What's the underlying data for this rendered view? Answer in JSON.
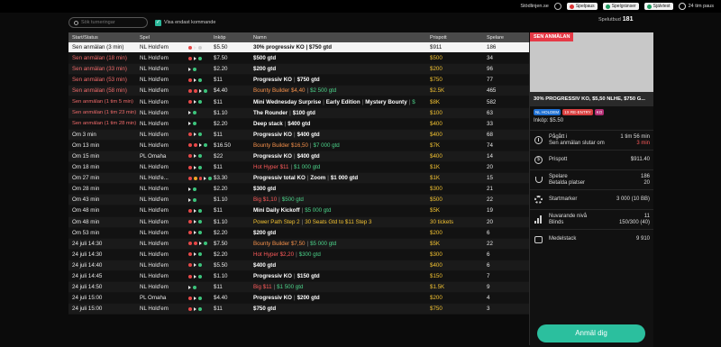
{
  "topbar": {
    "site": "Stödlinjen.se",
    "badges": [
      "Spelpaus",
      "Spelgränser",
      "Självtest"
    ],
    "session": "24 tim paus"
  },
  "filters": {
    "search_placeholder": "Sök turneringar",
    "upcoming_label": "Visa endast kommande",
    "spelutbud_label": "Spelutbud",
    "spelutbud_count": "181"
  },
  "table": {
    "headers": [
      "Start/Status",
      "Spel",
      "Inköp",
      "Namn",
      "Prispott",
      "Spelare"
    ],
    "rows": [
      {
        "start": "Sen anmälan (3 min)",
        "spel": "NL Hold'em",
        "inkop": "$5.50",
        "namn": [
          {
            "t": "30% progressiv KO | $750 gtd",
            "c": "white"
          }
        ],
        "prispott": "$911",
        "spelare": "186",
        "state": "white",
        "sel": true,
        "icons": [
          "r",
          "tri",
          "w"
        ]
      },
      {
        "start": "Sen anmälan (18 min)",
        "spel": "NL Hold'em",
        "inkop": "$7.50",
        "namn": [
          {
            "t": "$500 gtd",
            "c": "white"
          }
        ],
        "prispott": "$500",
        "spelare": "34",
        "state": "red",
        "icons": [
          "r",
          "tri",
          "g"
        ]
      },
      {
        "start": "Sen anmälan (33 min)",
        "spel": "NL Hold'em",
        "inkop": "$2.20",
        "namn": [
          {
            "t": "$200 gtd",
            "c": "white"
          }
        ],
        "prispott": "$200",
        "spelare": "96",
        "state": "red",
        "icons": [
          "tri",
          "g"
        ]
      },
      {
        "start": "Sen anmälan (53 min)",
        "spel": "NL Hold'em",
        "inkop": "$11",
        "namn": [
          {
            "t": "Progressiv KO",
            "c": "white"
          },
          {
            "t": "|",
            "c": "sep"
          },
          {
            "t": "$750 gtd",
            "c": "white"
          }
        ],
        "prispott": "$750",
        "spelare": "77",
        "state": "red",
        "icons": [
          "r",
          "tri",
          "g"
        ]
      },
      {
        "start": "Sen anmälan (58 min)",
        "spel": "NL Hold'em",
        "inkop": "$4.40",
        "namn": [
          {
            "t": "Bounty Builder $4,40",
            "c": "orange"
          },
          {
            "t": "|",
            "c": "sep"
          },
          {
            "t": "$2 500 gtd",
            "c": "green"
          }
        ],
        "prispott": "$2.5K",
        "spelare": "465",
        "state": "red",
        "icons": [
          "r",
          "r",
          "tri",
          "g"
        ]
      },
      {
        "start": "Sen anmälan (1 tim 5 min)",
        "spel": "NL Hold'em",
        "inkop": "$11",
        "namn": [
          {
            "t": "Mini Wednesday Surprise",
            "c": "white"
          },
          {
            "t": "|",
            "c": "sep"
          },
          {
            "t": "Early Edition",
            "c": "white"
          },
          {
            "t": "|",
            "c": "sep"
          },
          {
            "t": "Mystery Bounty",
            "c": "white"
          },
          {
            "t": "|",
            "c": "sep"
          },
          {
            "t": "$",
            "c": "green"
          }
        ],
        "prispott": "$8K",
        "spelare": "582",
        "state": "red",
        "two": true,
        "icons": [
          "r",
          "tri",
          "g"
        ]
      },
      {
        "start": "Sen anmälan (1 tim 23 min)",
        "spel": "NL Hold'em",
        "inkop": "$1.10",
        "namn": [
          {
            "t": "The Rounder",
            "c": "white"
          },
          {
            "t": "|",
            "c": "sep"
          },
          {
            "t": "$100 gtd",
            "c": "white"
          }
        ],
        "prispott": "$100",
        "spelare": "63",
        "state": "red",
        "two": true,
        "icons": [
          "tri",
          "g"
        ]
      },
      {
        "start": "Sen anmälan (1 tim 28 min)",
        "spel": "NL Hold'em",
        "inkop": "$2.20",
        "namn": [
          {
            "t": "Deep stack",
            "c": "white"
          },
          {
            "t": "|",
            "c": "sep"
          },
          {
            "t": "$400 gtd",
            "c": "white"
          }
        ],
        "prispott": "$400",
        "spelare": "33",
        "state": "red",
        "two": true,
        "icons": [
          "tri",
          "g"
        ]
      },
      {
        "start": "Om 3 min",
        "spel": "NL Hold'em",
        "inkop": "$11",
        "namn": [
          {
            "t": "Progressiv KO",
            "c": "white"
          },
          {
            "t": "|",
            "c": "sep"
          },
          {
            "t": "$400 gtd",
            "c": "white"
          }
        ],
        "prispott": "$400",
        "spelare": "68",
        "state": "white",
        "icons": [
          "r",
          "tri",
          "g"
        ]
      },
      {
        "start": "Om 13 min",
        "spel": "NL Hold'em",
        "inkop": "$16.50",
        "namn": [
          {
            "t": "Bounty Builder $16,50",
            "c": "orange"
          },
          {
            "t": "|",
            "c": "sep"
          },
          {
            "t": "$7 000 gtd",
            "c": "green"
          }
        ],
        "prispott": "$7K",
        "spelare": "74",
        "state": "white",
        "icons": [
          "r",
          "r",
          "tri",
          "g"
        ]
      },
      {
        "start": "Om 15 min",
        "spel": "PL Omaha",
        "inkop": "$22",
        "namn": [
          {
            "t": "Progressiv KO",
            "c": "white"
          },
          {
            "t": "|",
            "c": "sep"
          },
          {
            "t": "$400 gtd",
            "c": "white"
          }
        ],
        "prispott": "$400",
        "spelare": "14",
        "state": "white",
        "icons": [
          "r",
          "tri",
          "g"
        ]
      },
      {
        "start": "Om 18 min",
        "spel": "NL Hold'em",
        "inkop": "$11",
        "namn": [
          {
            "t": "Hot Hyper $11",
            "c": "red"
          },
          {
            "t": "|",
            "c": "sep"
          },
          {
            "t": "$1 000 gtd",
            "c": "green"
          }
        ],
        "prispott": "$1K",
        "spelare": "20",
        "state": "white",
        "icons": [
          "r",
          "tri",
          "g"
        ]
      },
      {
        "start": "Om 27 min",
        "spel": "NL Hold'e...",
        "inkop": "$3.30",
        "namn": [
          {
            "t": "Progressiv total KO",
            "c": "white"
          },
          {
            "t": "|",
            "c": "sep"
          },
          {
            "t": "Zoom",
            "c": "white"
          },
          {
            "t": "|",
            "c": "sep"
          },
          {
            "t": "$1 000 gtd",
            "c": "white"
          }
        ],
        "prispott": "$1K",
        "spelare": "15",
        "state": "white",
        "icons": [
          "r",
          "o",
          "r",
          "tri",
          "g"
        ]
      },
      {
        "start": "Om 28 min",
        "spel": "NL Hold'em",
        "inkop": "$2.20",
        "namn": [
          {
            "t": "$300 gtd",
            "c": "white"
          }
        ],
        "prispott": "$300",
        "spelare": "21",
        "state": "white",
        "icons": [
          "tri",
          "g"
        ]
      },
      {
        "start": "Om 43 min",
        "spel": "NL Hold'em",
        "inkop": "$1.10",
        "namn": [
          {
            "t": "Big $1,10",
            "c": "red"
          },
          {
            "t": "|",
            "c": "sep"
          },
          {
            "t": "$500 gtd",
            "c": "green"
          }
        ],
        "prispott": "$500",
        "spelare": "22",
        "state": "white",
        "icons": [
          "tri",
          "g"
        ]
      },
      {
        "start": "Om 48 min",
        "spel": "NL Hold'em",
        "inkop": "$11",
        "namn": [
          {
            "t": "Mini Daily Kickoff",
            "c": "white"
          },
          {
            "t": "|",
            "c": "sep"
          },
          {
            "t": "$5 000 gtd",
            "c": "green"
          }
        ],
        "prispott": "$5K",
        "spelare": "19",
        "state": "white",
        "icons": [
          "r",
          "tri",
          "g"
        ]
      },
      {
        "start": "Om 48 min",
        "spel": "NL Hold'em",
        "inkop": "$1.10",
        "namn": [
          {
            "t": "Power Path Step 2",
            "c": "yellow"
          },
          {
            "t": "|",
            "c": "sep"
          },
          {
            "t": "30 Seats Gtd to $11 Step 3",
            "c": "yellow"
          }
        ],
        "prispott": "30 tickets",
        "spelare": "20",
        "state": "white",
        "pzy": true,
        "icons": [
          "r",
          "tri",
          "g"
        ]
      },
      {
        "start": "Om 53 min",
        "spel": "NL Hold'em",
        "inkop": "$2.20",
        "namn": [
          {
            "t": "$200 gtd",
            "c": "white"
          }
        ],
        "prispott": "$200",
        "spelare": "6",
        "state": "white",
        "icons": [
          "r",
          "tri",
          "g"
        ]
      },
      {
        "start": "24 juli 14:30",
        "spel": "NL Hold'em",
        "inkop": "$7.50",
        "namn": [
          {
            "t": "Bounty Builder $7,50",
            "c": "orange"
          },
          {
            "t": "|",
            "c": "sep"
          },
          {
            "t": "$5 000 gtd",
            "c": "green"
          }
        ],
        "prispott": "$5K",
        "spelare": "22",
        "state": "white",
        "icons": [
          "r",
          "r",
          "tri",
          "g"
        ]
      },
      {
        "start": "24 juli 14:30",
        "spel": "NL Hold'em",
        "inkop": "$2.20",
        "namn": [
          {
            "t": "Hot Hyper $2,20",
            "c": "red"
          },
          {
            "t": "|",
            "c": "sep"
          },
          {
            "t": "$300 gtd",
            "c": "green"
          }
        ],
        "prispott": "$300",
        "spelare": "6",
        "state": "white",
        "icons": [
          "r",
          "tri",
          "g"
        ]
      },
      {
        "start": "24 juli 14:40",
        "spel": "NL Hold'em",
        "inkop": "$5.50",
        "namn": [
          {
            "t": "$400 gtd",
            "c": "white"
          }
        ],
        "prispott": "$400",
        "spelare": "6",
        "state": "white",
        "icons": [
          "r",
          "tri",
          "g"
        ]
      },
      {
        "start": "24 juli 14:45",
        "spel": "NL Hold'em",
        "inkop": "$1.10",
        "namn": [
          {
            "t": "Progressiv KO",
            "c": "white"
          },
          {
            "t": "|",
            "c": "sep"
          },
          {
            "t": "$150 gtd",
            "c": "white"
          }
        ],
        "prispott": "$150",
        "spelare": "7",
        "state": "white",
        "icons": [
          "r",
          "tri",
          "g"
        ]
      },
      {
        "start": "24 juli 14:50",
        "spel": "NL Hold'em",
        "inkop": "$11",
        "namn": [
          {
            "t": "Big $11",
            "c": "red"
          },
          {
            "t": "|",
            "c": "sep"
          },
          {
            "t": "$1 500 gtd",
            "c": "green"
          }
        ],
        "prispott": "$1.5K",
        "spelare": "9",
        "state": "white",
        "icons": [
          "tri",
          "g"
        ]
      },
      {
        "start": "24 juli 15:00",
        "spel": "PL Omaha",
        "inkop": "$4.40",
        "namn": [
          {
            "t": "Progressiv KO",
            "c": "white"
          },
          {
            "t": "|",
            "c": "sep"
          },
          {
            "t": "$200 gtd",
            "c": "white"
          }
        ],
        "prispott": "$200",
        "spelare": "4",
        "state": "white",
        "icons": [
          "r",
          "tri",
          "g"
        ]
      },
      {
        "start": "24 juli 15:00",
        "spel": "NL Hold'em",
        "inkop": "$11",
        "namn": [
          {
            "t": "$750 gtd",
            "c": "white"
          }
        ],
        "prispott": "$750",
        "spelare": "3",
        "state": "white",
        "icons": [
          "r",
          "tri",
          "g"
        ]
      }
    ]
  },
  "panel": {
    "tag": "SEN ANMÄLAN",
    "title": "30% PROGRESSIV KO, $5,50 NLHE, $750 G...",
    "badges": [
      "NL HOLDEM",
      "1X RE-ENTRY",
      "KO"
    ],
    "inkop": "Inköp: $5.50",
    "pagar_label": "Pågått i",
    "pagar_value": "1 tim 56 min",
    "sen_label": "Sen anmälan slutar om",
    "sen_value": "3 min",
    "prispott_label": "Prispott",
    "prispott_value": "$911.40",
    "spelare_label": "Spelare",
    "spelare_value": "186",
    "betalda_label": "Betalda platser",
    "betalda_value": "20",
    "startmarker_label": "Startmarker",
    "startmarker_value": "3 000 (10 BB)",
    "niva_label": "Nuvarande nivå",
    "niva_value": "11",
    "blinds_label": "Blinds",
    "blinds_value": "150/300 (40)",
    "medelstack_label": "Medelstack",
    "medelstack_value": "9 910",
    "cta": "Anmäl dig"
  },
  "colors": {
    "accent": "#2bbf9e",
    "late_reg": "#f06a6a",
    "prize": "#f2c232",
    "banner_tag": "#e63946"
  }
}
